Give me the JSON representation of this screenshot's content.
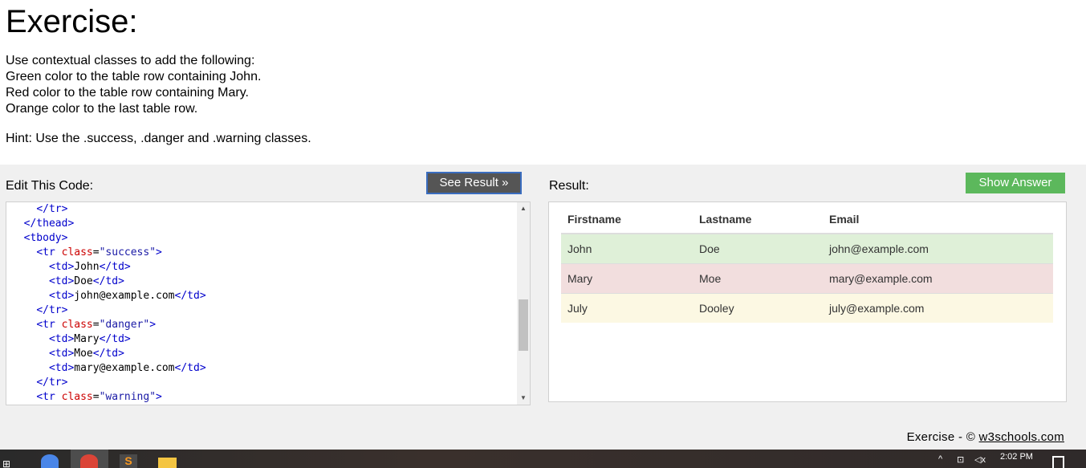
{
  "header": {
    "title": "Exercise:",
    "instructions": [
      "Use contextual classes to add the following:",
      "Green color to the table row containing John.",
      "Red color to the table row containing Mary.",
      "Orange color to the last table row."
    ],
    "hint": "Hint: Use the .success, .danger and .warning classes."
  },
  "editor": {
    "label": "Edit This Code:",
    "see_result_label": "See Result »"
  },
  "result": {
    "label": "Result:",
    "show_answer_label": "Show Answer",
    "columns": [
      "Firstname",
      "Lastname",
      "Email"
    ],
    "rows": [
      {
        "class": "success",
        "cells": [
          "John",
          "Doe",
          "john@example.com"
        ]
      },
      {
        "class": "danger",
        "cells": [
          "Mary",
          "Moe",
          "mary@example.com"
        ]
      },
      {
        "class": "warning",
        "cells": [
          "July",
          "Dooley",
          "july@example.com"
        ]
      }
    ]
  },
  "footer": {
    "prefix": "Exercise - © ",
    "link": "w3schools.com"
  },
  "taskbar": {
    "time": "2:02 PM"
  },
  "colors": {
    "success": "#dff0d8",
    "danger": "#f2dede",
    "warning": "#fcf8e3",
    "show_answer": "#5cb85c",
    "see_result": "#555555"
  }
}
